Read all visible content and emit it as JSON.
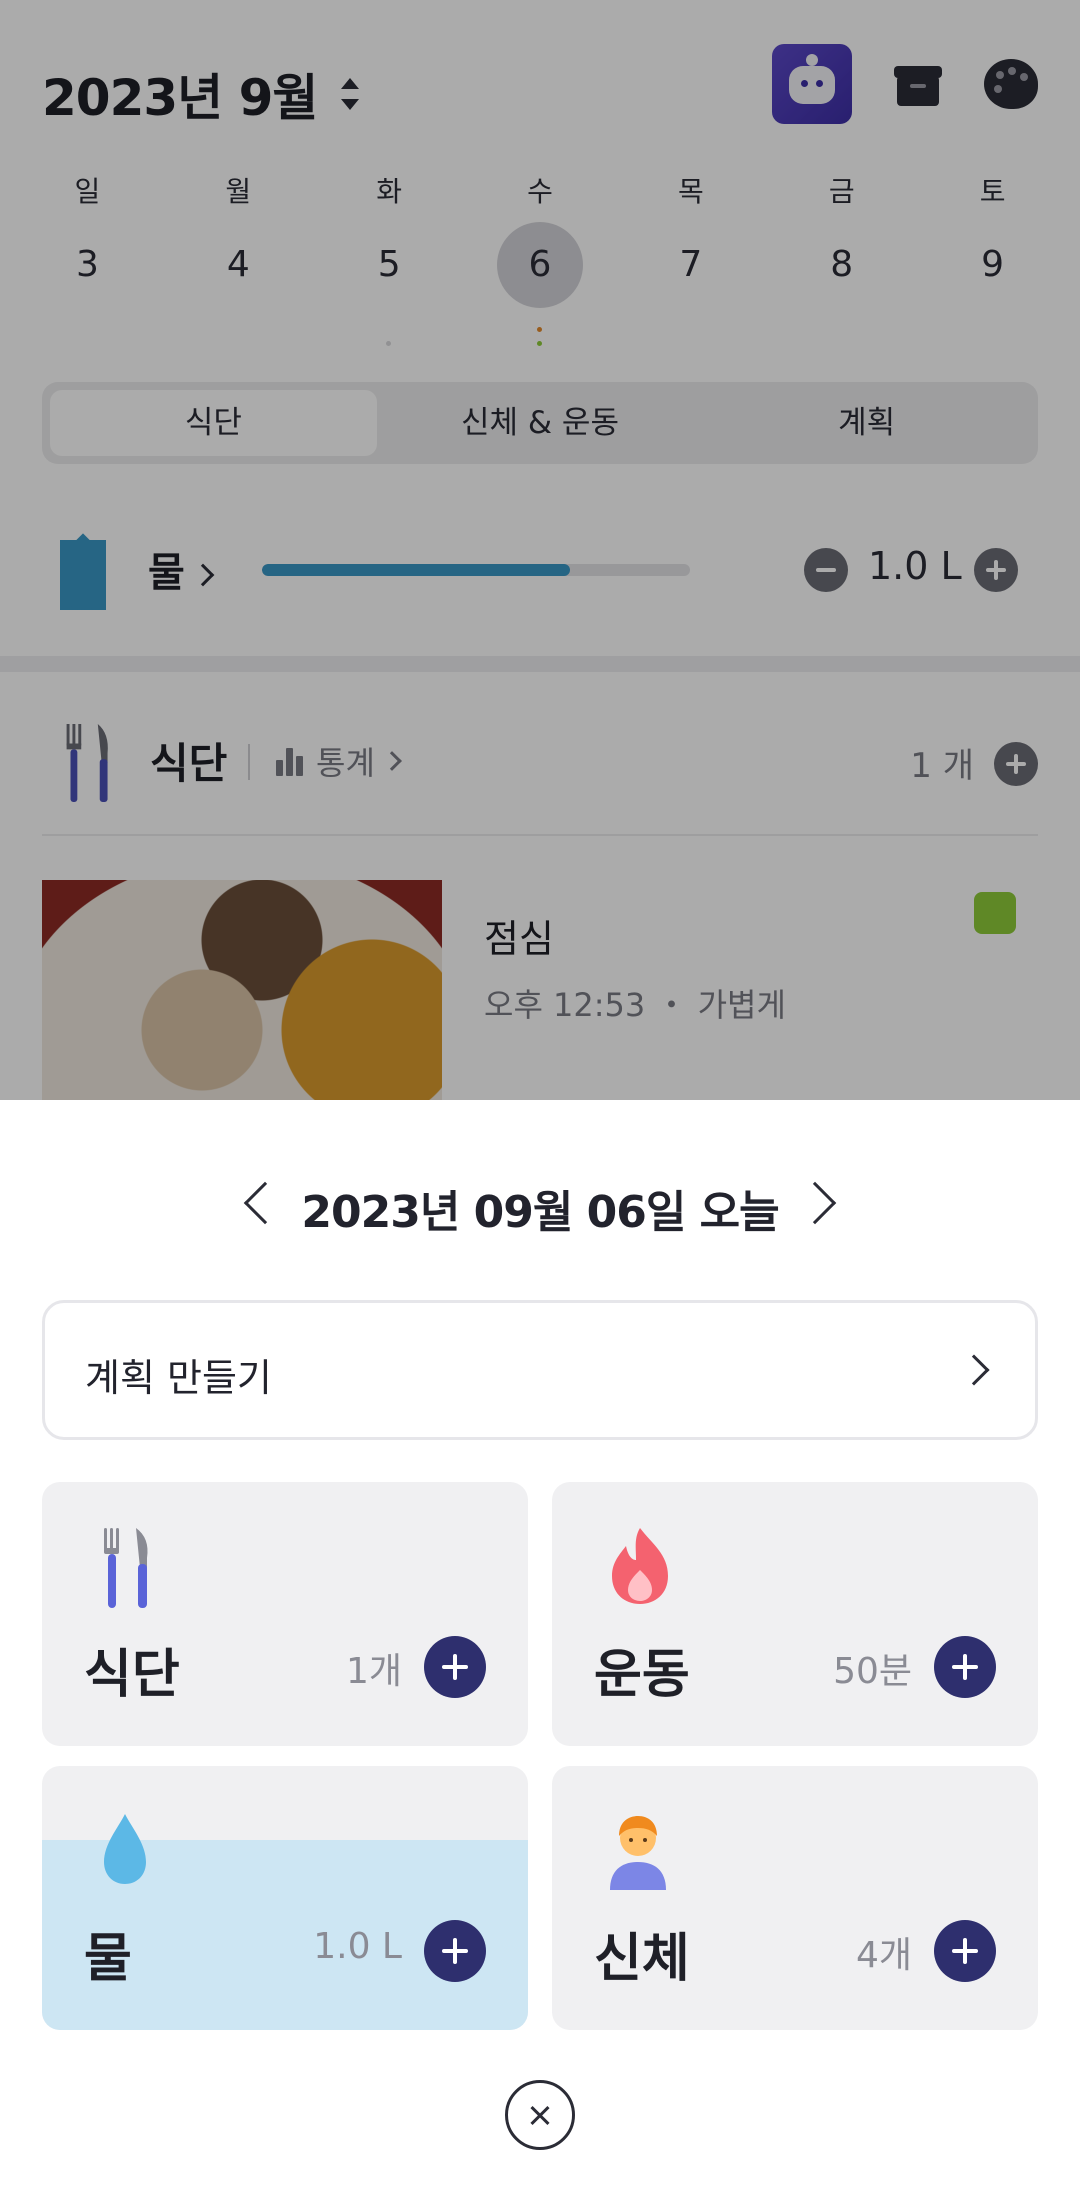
{
  "header": {
    "month_title": "2023년 9월"
  },
  "week": {
    "days": [
      "일",
      "월",
      "화",
      "수",
      "목",
      "금",
      "토"
    ],
    "dates": [
      "3",
      "4",
      "5",
      "6",
      "7",
      "8",
      "9"
    ],
    "selected_index": 3
  },
  "segment": {
    "tabs": [
      "식단",
      "신체 & 운동",
      "계획"
    ],
    "active_index": 0
  },
  "water": {
    "label": "물",
    "amount": "1.0 L",
    "progress": 0.72,
    "color": "#3a97c5"
  },
  "meal_section": {
    "title": "식단",
    "stats_label": "통계",
    "count": "1 개"
  },
  "meal_item": {
    "name": "점심",
    "meta": "오후 12:53  ・  가볍게",
    "tag_color": "#8ecb3a"
  },
  "sheet": {
    "date_label": "2023년 09월 06일 오늘",
    "plan_label": "계획 만들기",
    "cards": {
      "meal": {
        "title": "식단",
        "value": "1개",
        "icon": "fork-knife-icon"
      },
      "exercise": {
        "title": "운동",
        "value": "50분",
        "icon": "flame-icon"
      },
      "water": {
        "title": "물",
        "value": "1.0 L",
        "icon": "water-drop-icon",
        "fill_level": 0.72
      },
      "body": {
        "title": "신체",
        "value": "4개",
        "icon": "person-icon"
      }
    },
    "accent_color": "#2e2f6e"
  }
}
